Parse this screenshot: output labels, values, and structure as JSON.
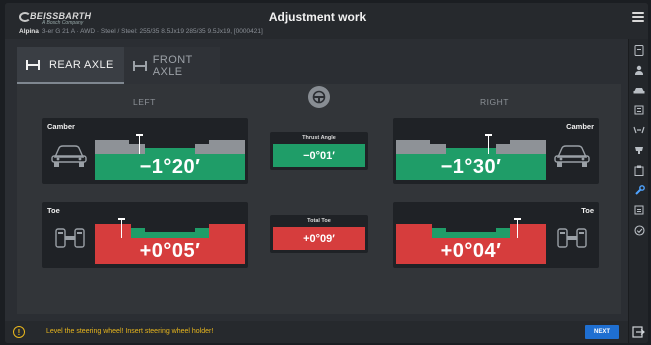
{
  "header": {
    "logo_text": "BEISSBARTH",
    "logo_sub": "A Bosch Company",
    "title": "Adjustment work",
    "vehicle_make": "Alpina",
    "vehicle_desc": "3-er G 21 A · AWD · Steel / Steel: 255/35 8.5Jx19 285/35 9.5Jx19, [0000421]"
  },
  "tabs": [
    {
      "label": "REAR AXLE",
      "active": true,
      "icon": "rear-axle-icon"
    },
    {
      "label": "FRONT AXLE",
      "active": false,
      "icon": "front-axle-icon"
    }
  ],
  "columns": {
    "left": "LEFT",
    "right": "RIGHT"
  },
  "rows": {
    "camber": {
      "label": "Camber",
      "left_value": "−1°20′",
      "right_value": "−1°30′",
      "left_status": "in-tolerance",
      "right_status": "in-tolerance",
      "center_label": "Thrust Angle",
      "center_value": "−0°01′",
      "center_status": "in-tolerance"
    },
    "toe": {
      "label": "Toe",
      "left_value": "+0°05′",
      "right_value": "+0°04′",
      "left_status": "out-of-tolerance",
      "right_status": "out-of-tolerance",
      "center_label": "Total Toe",
      "center_value": "+0°09′",
      "center_status": "out-of-tolerance"
    }
  },
  "footer": {
    "message": "Level the steering wheel! Insert steering wheel holder!",
    "next_label": "NEXT"
  },
  "sidebar_icons": [
    "document-icon",
    "user-icon",
    "car-icon",
    "list-icon",
    "measure-icon",
    "wheel-icon",
    "clipboard-icon",
    "wrench-icon",
    "report-icon",
    "check-circle-icon"
  ],
  "colors": {
    "ok": "#1f9d68",
    "bad": "#d63d3d",
    "accent": "#1f6fd1",
    "warning": "#e8b61d"
  }
}
